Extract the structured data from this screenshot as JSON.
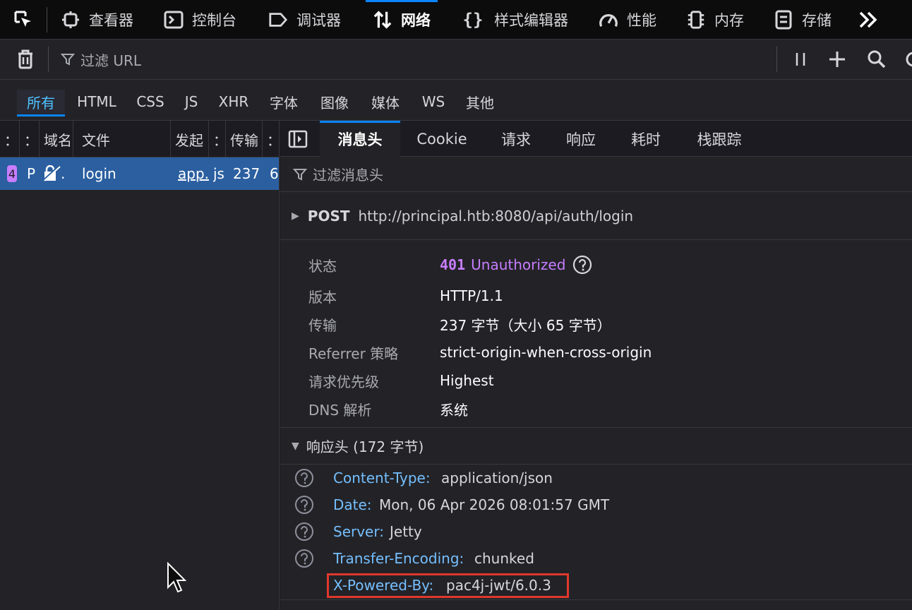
{
  "toolbar": {
    "tabs": [
      {
        "label": "查看器",
        "icon": "inspector-icon"
      },
      {
        "label": "控制台",
        "icon": "console-icon"
      },
      {
        "label": "调试器",
        "icon": "debugger-icon"
      },
      {
        "label": "网络",
        "icon": "network-icon"
      },
      {
        "label": "样式编辑器",
        "icon": "style-editor-icon"
      },
      {
        "label": "性能",
        "icon": "performance-icon"
      },
      {
        "label": "内存",
        "icon": "memory-icon"
      },
      {
        "label": "存储",
        "icon": "storage-icon"
      }
    ],
    "active_tab": "网络"
  },
  "filter": {
    "placeholder": "过滤 URL"
  },
  "types": [
    "所有",
    "HTML",
    "CSS",
    "JS",
    "XHR",
    "字体",
    "图像",
    "媒体",
    "WS",
    "其他"
  ],
  "active_type": "所有",
  "request_list": {
    "columns": [
      "：",
      "：",
      "域名",
      "文件",
      "发起",
      "：",
      "传输",
      "："
    ],
    "row": {
      "status": "4",
      "method": "P",
      "domain": ".",
      "file": "login",
      "initiator": "app.",
      "type": "js",
      "transferred": "237",
      "size": "6"
    }
  },
  "detail": {
    "tabs": [
      "消息头",
      "Cookie",
      "请求",
      "响应",
      "耗时",
      "栈跟踪"
    ],
    "active_tab": "消息头",
    "header_filter_placeholder": "过滤消息头",
    "method": "POST",
    "url": "http://principal.htb:8080/api/auth/login",
    "summary": {
      "status_label": "状态",
      "status_code": "401",
      "status_text": "Unauthorized",
      "version_label": "版本",
      "version": "HTTP/1.1",
      "transfer_label": "传输",
      "transfer": "237 字节（大小 65 字节）",
      "referrer_label": "Referrer 策略",
      "referrer": "strict-origin-when-cross-origin",
      "priority_label": "请求优先级",
      "priority": "Highest",
      "dns_label": "DNS 解析",
      "dns": "系统"
    },
    "response_headers_title": "响应头 (172 字节)",
    "response_headers": [
      {
        "name": "Content-Type:",
        "value": "application/json"
      },
      {
        "name": "Date:",
        "value": "Mon, 06 Apr 2026 08:01:57 GMT"
      },
      {
        "name": "Server:",
        "value": "Jetty"
      },
      {
        "name": "Transfer-Encoding:",
        "value": "chunked"
      },
      {
        "name": "X-Powered-By:",
        "value": "pac4j-jwt/6.0.3"
      }
    ]
  },
  "colors": {
    "accent": "#0a84ff",
    "status_4xx": "#c77dff",
    "header_name": "#75bfff",
    "highlight": "#e0382c",
    "selected_row": "#2b5fa0"
  }
}
